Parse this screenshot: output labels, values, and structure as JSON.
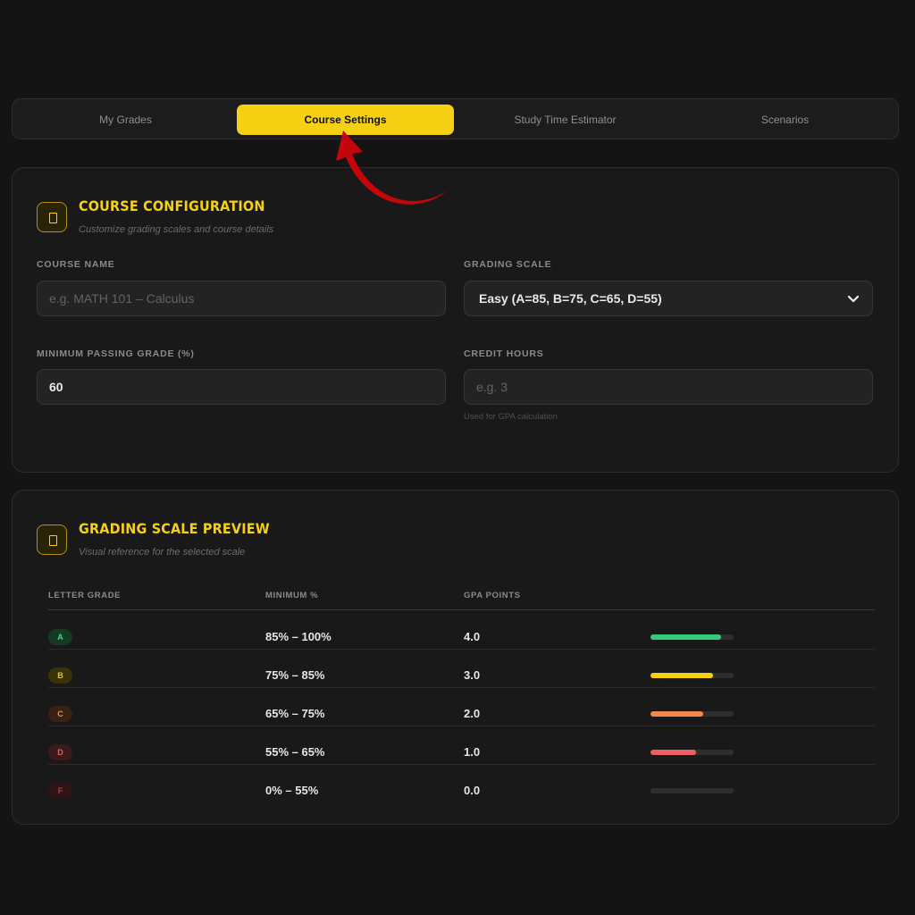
{
  "tabs": [
    {
      "label": "My Grades",
      "active": false
    },
    {
      "label": "Course Settings",
      "active": true
    },
    {
      "label": "Study Time Estimator",
      "active": false
    },
    {
      "label": "Scenarios",
      "active": false
    }
  ],
  "config": {
    "title": "Course Configuration",
    "subtitle": "Customize grading scales and course details",
    "icon": "notebook-icon",
    "course_name": {
      "label": "COURSE NAME",
      "value": "",
      "placeholder": "e.g. MATH 101 – Calculus"
    },
    "grading_scale": {
      "label": "GRADING SCALE",
      "value": "Easy (A=85, B=75, C=65, D=55)"
    },
    "min_passing": {
      "label": "MINIMUM PASSING GRADE (%)",
      "value": "60"
    },
    "credit_hours": {
      "label": "CREDIT HOURS",
      "value": "",
      "placeholder": "e.g. 3",
      "helper": "Used for GPA calculation"
    }
  },
  "preview": {
    "title": "Grading Scale Preview",
    "subtitle": "Visual reference for the selected scale",
    "icon": "notebook-icon",
    "columns": [
      "LETTER GRADE",
      "MINIMUM %",
      "GPA POINTS"
    ],
    "rows": [
      {
        "letter": "A",
        "range": "85% – 100%",
        "gpa": "4.0",
        "fraction": 0.85,
        "color": "#35c979",
        "pill_bg": "#143a24",
        "pill_fg": "#47d486"
      },
      {
        "letter": "B",
        "range": "75% – 85%",
        "gpa": "3.0",
        "fraction": 0.75,
        "color": "#f6d012",
        "pill_bg": "#3a3208",
        "pill_fg": "#e8c413"
      },
      {
        "letter": "C",
        "range": "65% – 75%",
        "gpa": "2.0",
        "fraction": 0.63,
        "color": "#f2884a",
        "pill_bg": "#3a2213",
        "pill_fg": "#e98a4f"
      },
      {
        "letter": "D",
        "range": "55% – 65%",
        "gpa": "1.0",
        "fraction": 0.55,
        "color": "#ee5f63",
        "pill_bg": "#3b1a1a",
        "pill_fg": "#e4605f"
      },
      {
        "letter": "F",
        "range": "0% – 55%",
        "gpa": "0.0",
        "fraction": 0.0,
        "color": "#b23a3a",
        "pill_bg": "#2e1414",
        "pill_fg": "#b23f3f"
      }
    ]
  },
  "colors": {
    "accent": "#f6d012",
    "annotation_arrow": "#c4060c"
  }
}
